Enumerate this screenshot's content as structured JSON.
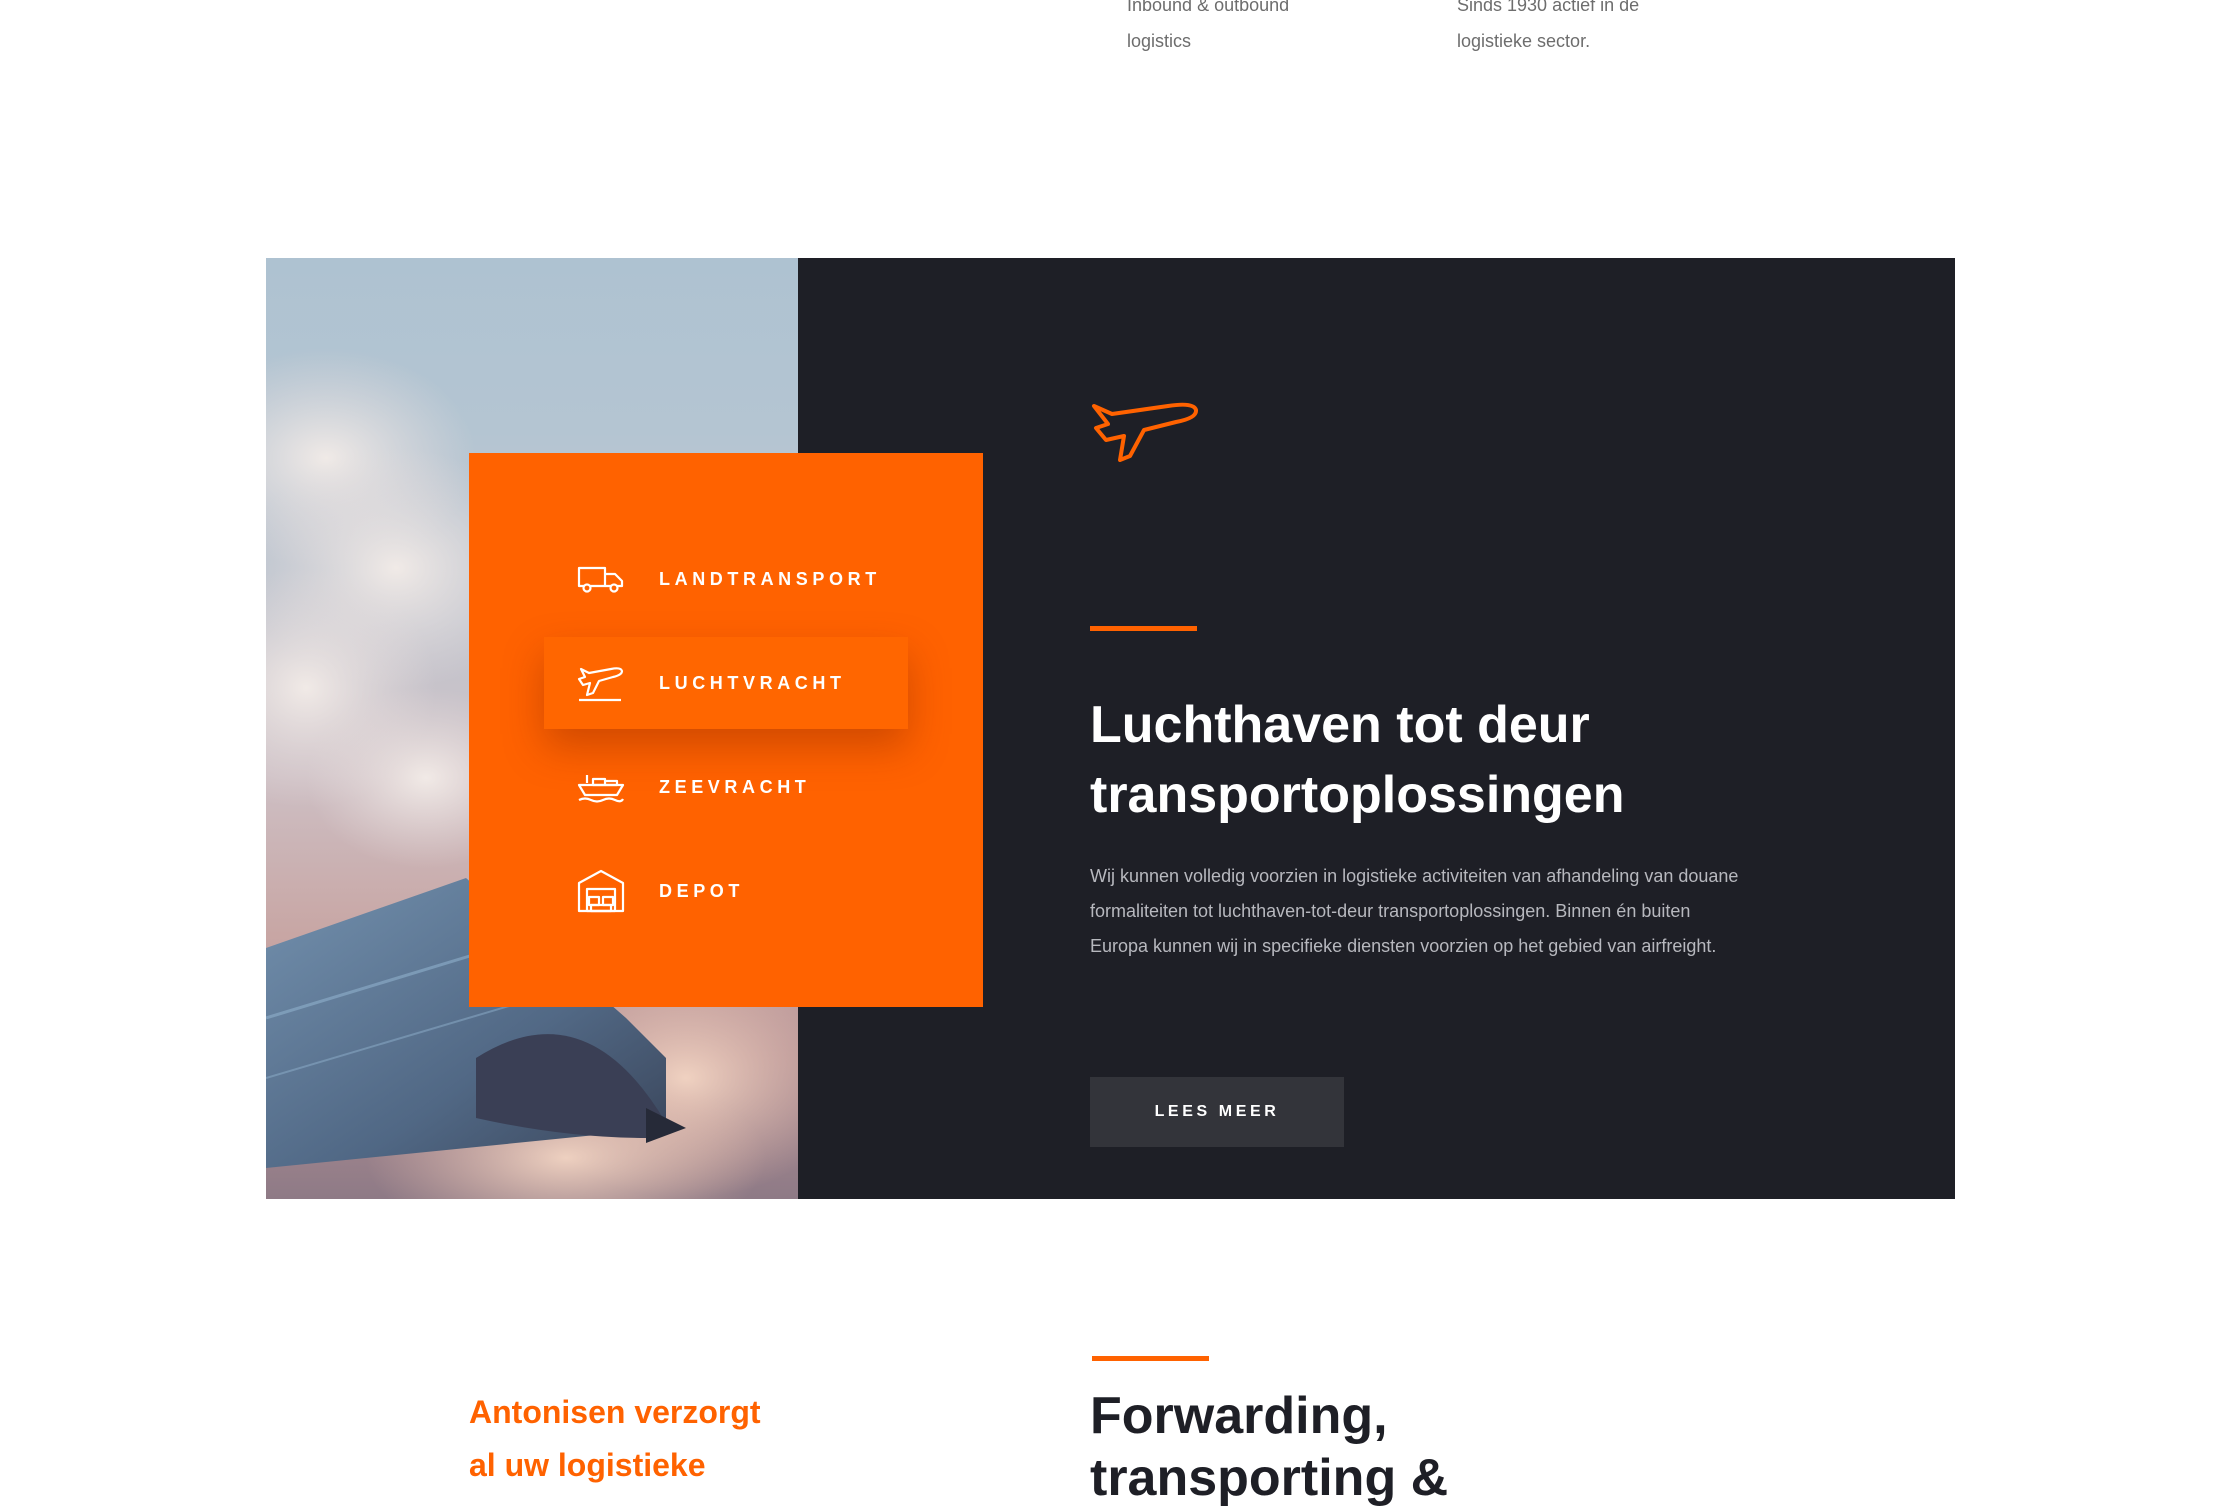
{
  "top_features": [
    {
      "text_line1": "Inbound & outbound",
      "text_line2": "logistics"
    },
    {
      "text_line1": "Sinds 1930 actief in de",
      "text_line2": "logistieke sector."
    }
  ],
  "services": {
    "items": [
      {
        "label": "LANDTRANSPORT",
        "icon": "truck-icon",
        "active": false
      },
      {
        "label": "LUCHTVRACHT",
        "icon": "plane-icon",
        "active": true
      },
      {
        "label": "ZEEVRACHT",
        "icon": "ship-icon",
        "active": false
      },
      {
        "label": "DEPOT",
        "icon": "warehouse-icon",
        "active": false
      }
    ]
  },
  "content": {
    "icon": "plane-icon",
    "heading_line1": "Luchthaven tot deur",
    "heading_line2": "transportoplossingen",
    "body": "Wij kunnen volledig voorzien in logistieke activiteiten van afhandeling van douane formaliteiten tot luchthaven-tot-deur transportoplossingen. Binnen én buiten Europa kunnen wij in specifieke diensten voorzien op het gebied van airfreight.",
    "button_label": "LEES MEER"
  },
  "bottom": {
    "left_line1": "Antonisen verzorgt",
    "left_line2": "al uw logistieke",
    "heading_line1": "Forwarding,",
    "heading_line2": "transporting &"
  },
  "colors": {
    "accent": "#ff6200",
    "dark_bg": "#1e1f26",
    "button_bg": "#33343a"
  }
}
